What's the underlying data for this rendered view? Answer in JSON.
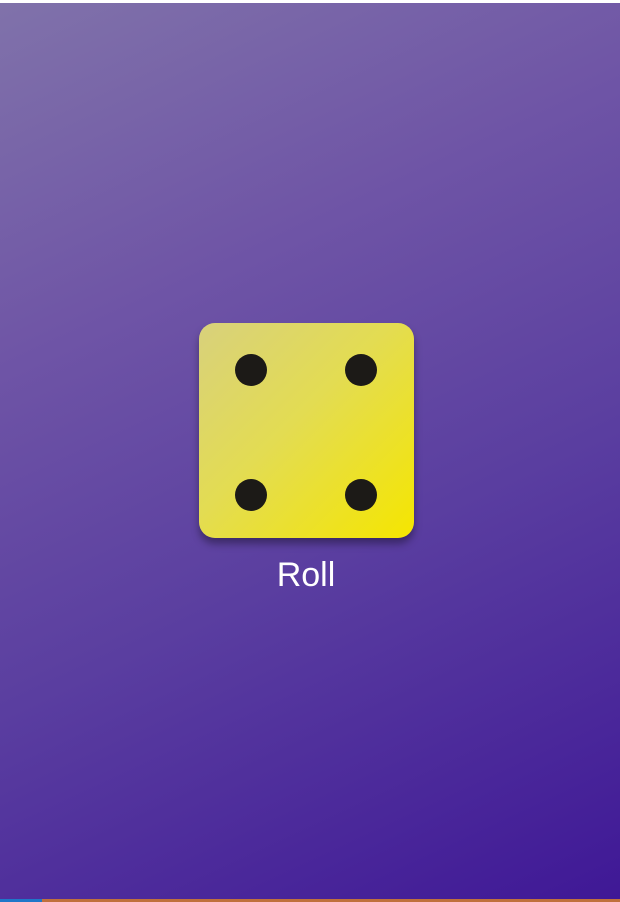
{
  "die": {
    "face_value": 4,
    "pip_color": "#1c1a17",
    "gradient_colors": [
      "#d8d17c",
      "#f5e600"
    ]
  },
  "roll_button": {
    "label": "Roll"
  },
  "theme": {
    "background_gradient": [
      "#8072aa",
      "#3f1896"
    ],
    "text_color": "#ffffff"
  }
}
